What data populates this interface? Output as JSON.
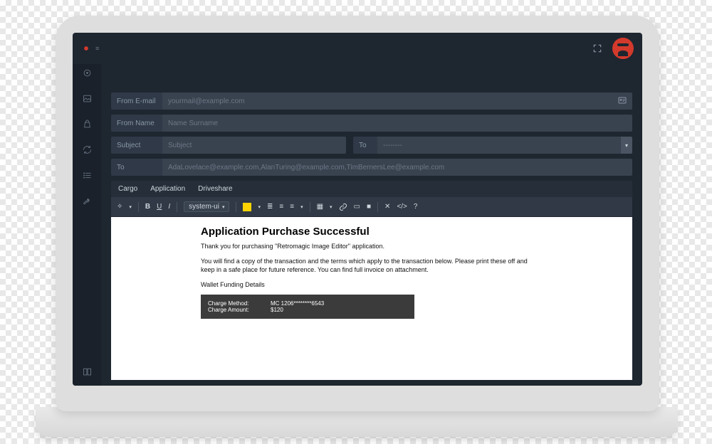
{
  "topbar": {
    "brand_text": "",
    "fullscreen_title": "Fullscreen"
  },
  "fields": {
    "from_email": {
      "label": "From E-mail",
      "placeholder": "yourmail@example.com",
      "trailing_icon": "contact-card"
    },
    "from_name": {
      "label": "From Name",
      "placeholder": "Name Surname"
    },
    "subject": {
      "label": "Subject",
      "placeholder": "Subject"
    },
    "to_select": {
      "label": "To",
      "value": "--------"
    },
    "to": {
      "label": "To",
      "value": "AdaLovelace@example.com,AlanTuring@example.com,TimBernersLee@example.com"
    }
  },
  "tabs": [
    "Cargo",
    "Application",
    "Driveshare"
  ],
  "editor": {
    "font": "system-ui",
    "highlight_color": "#ffd400"
  },
  "document": {
    "title": "Application Purchase Successful",
    "p1": "Thank you for purchasing \"Retromagic Image Editor\" application.",
    "p2": "You will find a copy of the transaction and the terms which apply to the transaction below. Please print these off and keep in a safe place for future reference. You can find full invoice on attachment.",
    "section_heading": "Wallet Funding Details",
    "charge_method_label": "Charge Method:",
    "charge_method_value": "MC 1206********6543",
    "charge_amount_label": "Charge Amount:",
    "charge_amount_value": "$120"
  }
}
